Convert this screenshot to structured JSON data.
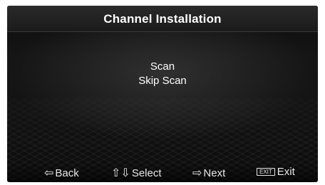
{
  "title": "Channel Installation",
  "menu": {
    "items": [
      {
        "label": "Scan"
      },
      {
        "label": "Skip Scan"
      }
    ]
  },
  "footer": {
    "back": {
      "glyph": "⇦",
      "label": "Back"
    },
    "select": {
      "glyph": "⇧⇩",
      "label": "Select"
    },
    "next": {
      "glyph": "⇨",
      "label": "Next"
    },
    "exit": {
      "key_label": "EXIT",
      "label": "Exit"
    }
  }
}
